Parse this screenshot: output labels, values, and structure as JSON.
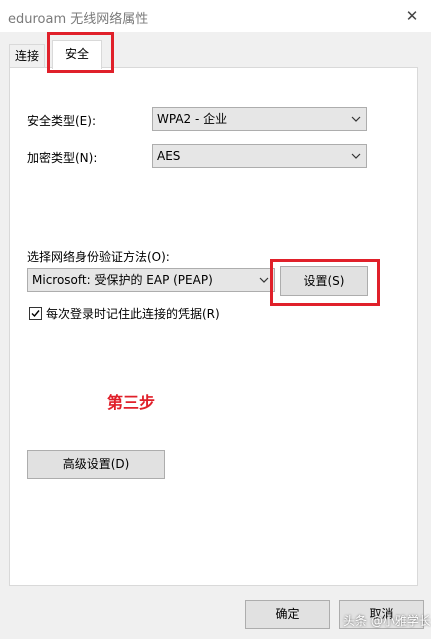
{
  "window": {
    "title": "eduroam 无线网络属性",
    "close_glyph": "✕"
  },
  "tabs": [
    {
      "label": "连接",
      "active": false
    },
    {
      "label": "安全",
      "active": true
    }
  ],
  "security": {
    "type_label": "安全类型(E):",
    "type_value": "WPA2 - 企业",
    "encryption_label": "加密类型(N):",
    "encryption_value": "AES",
    "auth_method_label": "选择网络身份验证方法(O):",
    "auth_method_value": "Microsoft: 受保护的 EAP (PEAP)",
    "settings_button": "设置(S)",
    "remember_label": "每次登录时记住此连接的凭据(R)",
    "remember_checked": true,
    "advanced_button": "高级设置(D)"
  },
  "annotation": {
    "step_text": "第三步",
    "highlight_color": "#e0202a"
  },
  "footer": {
    "ok_button": "确定",
    "cancel_button": "取消"
  },
  "watermark": "头条 @小雅学长"
}
